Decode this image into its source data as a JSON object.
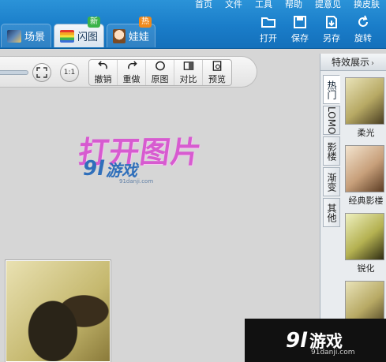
{
  "menu": [
    "首页",
    "文件",
    "工具",
    "帮助",
    "提意见",
    "换皮肤"
  ],
  "tabs": [
    {
      "label": "场景",
      "icon": "scene-icon",
      "badge": ""
    },
    {
      "label": "闪图",
      "icon": "flash-icon",
      "badge": "新"
    },
    {
      "label": "娃娃",
      "icon": "doll-icon",
      "badge": "热"
    }
  ],
  "actions": [
    "打开",
    "保存",
    "另存",
    "旋转"
  ],
  "toolbar": {
    "fit_label": "",
    "actual_size_label": "1:1",
    "tools": [
      "撤销",
      "重做",
      "原图",
      "对比",
      "预览"
    ]
  },
  "canvas": {
    "open_prompt": "打开图片",
    "logo_num": "9l",
    "logo_text": "游戏",
    "logo_url": "91danji.com"
  },
  "panel": {
    "title": "特效展示",
    "side_tabs": [
      "热门",
      "LOMO",
      "影楼",
      "渐变",
      "其他"
    ],
    "effects": [
      "柔光",
      "经典影楼",
      "锐化"
    ]
  },
  "watermark": {
    "num": "9l",
    "text": "游戏",
    "url": "91danji.com"
  },
  "colors": {
    "header": "#1a7dc9",
    "canvas_bg": "#d6d6d6",
    "prompt": "#d75bd0"
  }
}
